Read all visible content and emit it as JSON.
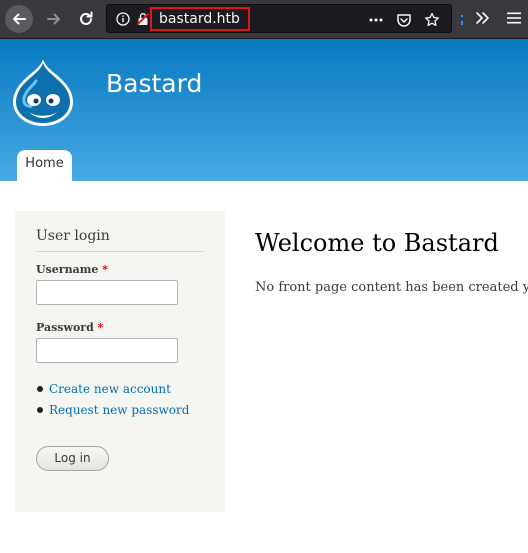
{
  "browser": {
    "url": "bastard.htb",
    "icons": {
      "back": "back-arrow-icon",
      "forward": "forward-arrow-icon",
      "reload": "reload-icon",
      "info": "info-icon",
      "insecure": "insecure-lock-icon",
      "more": "more-dots-icon",
      "pocket": "pocket-icon",
      "bookmark": "bookmark-star-icon",
      "overflow": "overflow-chevrons-icon",
      "menu": "hamburger-menu-icon"
    },
    "highlight_color": "#e0141e"
  },
  "site": {
    "name": "Bastard",
    "header_colors": [
      "#0779bf",
      "#48a9e4"
    ],
    "nav": [
      {
        "label": "Home",
        "active": true
      }
    ]
  },
  "sidebar": {
    "block_title": "User login",
    "username": {
      "label": "Username",
      "required_mark": "*",
      "value": ""
    },
    "password": {
      "label": "Password",
      "required_mark": "*",
      "value": ""
    },
    "links": [
      {
        "label": "Create new account"
      },
      {
        "label": "Request new password"
      }
    ],
    "login_button": "Log in"
  },
  "main": {
    "title": "Welcome to Bastard",
    "message": "No front page content has been created yet."
  },
  "colors": {
    "link": "#0071b3",
    "required": "#e00000"
  }
}
